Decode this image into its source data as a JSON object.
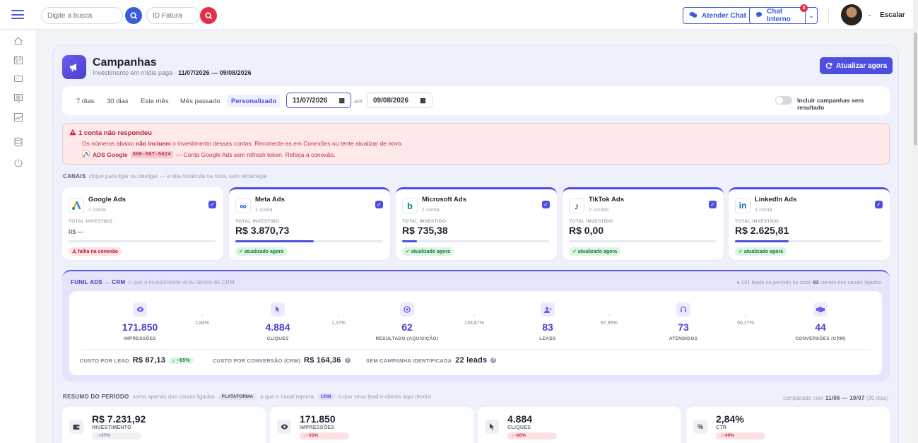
{
  "topbar": {
    "search_placeholder": "Digite a busca",
    "invoice_placeholder": "ID Fatura",
    "atender_chat": "Atender Chat",
    "chat_interno": "Chat Interno",
    "chat_badge": "3",
    "user_menu": "Escalar"
  },
  "header": {
    "title": "Campanhas",
    "subtitle_prefix": "Investimento em mídia paga ·",
    "subtitle_range": "11/07/2026 — 09/08/2026",
    "refresh_label": "Atualizar agora"
  },
  "filters": {
    "periods": [
      "7 dias",
      "30 dias",
      "Este mês",
      "Mês passado",
      "Personalizado"
    ],
    "active_period": "Personalizado",
    "date_from": "11/07/2026",
    "until_label": "até",
    "date_to": "09/08/2026",
    "toggle_label": "Incluir campanhas sem resultado"
  },
  "alert": {
    "title": "1 conta não respondeu",
    "line_a": "Os números abaixo",
    "line_b": "não incluem",
    "line_c": "o investimento dessas contas. Reconecte-as em Conexões ou tente atualizar de novo.",
    "account_name": "ADS Google",
    "account_id": "660-567-5624",
    "account_msg": "— Conta Google Ads sem refresh token. Refaça a conexão."
  },
  "channels": {
    "label": "CANAIS",
    "hint": "clique para ligar ou desligar — a tela recalcula na hora, sem recarregar",
    "invested_label": "TOTAL INVESTIDO",
    "items": [
      {
        "name": "Google Ads",
        "count": "1 conta",
        "value": "R$ —",
        "status": "falha na conexão",
        "bar": 0
      },
      {
        "name": "Meta Ads",
        "count": "1 conta",
        "value": "R$ 3.870,73",
        "status": "atualizado agora",
        "bar": 0.535
      },
      {
        "name": "Microsoft Ads",
        "count": "1 conta",
        "value": "R$ 735,38",
        "status": "atualizado agora",
        "bar": 0.102
      },
      {
        "name": "TikTok Ads",
        "count": "2 contas",
        "value": "R$ 0,00",
        "status": "atualizado agora",
        "bar": 0
      },
      {
        "name": "LinkedIn Ads",
        "count": "1 conta",
        "value": "R$ 2.625,81",
        "status": "atualizado agora",
        "bar": 0.363
      }
    ]
  },
  "funnel": {
    "title": "FUNIL ADS → CRM",
    "hint": "o que o investimento virou dentro do CRM",
    "note_a": "101 leads no período no total;",
    "note_b": "83",
    "note_c": "vieram dos canais ligados",
    "steps": [
      {
        "value": "171.850",
        "label": "IMPRESSÕES",
        "icon": "eye-icon"
      },
      {
        "value": "4.884",
        "label": "CLIQUES",
        "icon": "cursor-icon"
      },
      {
        "value": "62",
        "label": "RESULTADO (AQUISIÇÃO)",
        "icon": "target-icon"
      },
      {
        "value": "83",
        "label": "LEADS",
        "icon": "user-plus-icon"
      },
      {
        "value": "73",
        "label": "ATENDIDOS",
        "icon": "headset-icon"
      },
      {
        "value": "44",
        "label": "CONVERSÕES (CRM)",
        "icon": "handshake-icon"
      }
    ],
    "rates": [
      "2,84%",
      "1,27%",
      "133,87%",
      "87,95%",
      "60,27%"
    ],
    "cpl_label": "CUSTO POR LEAD",
    "cpl_value": "R$ 87,13",
    "cpl_delta": "↓ −65%",
    "cpc_label": "CUSTO POR CONVERSÃO (CRM)",
    "cpc_value": "R$ 164,36",
    "noc_label": "SEM CAMPANHA IDENTIFICADA",
    "noc_value": "22 leads"
  },
  "summary": {
    "label": "RESUMO DO PERÍODO",
    "hint_a": "soma apenas dos canais ligados",
    "tag_platform": "PLATAFORMA",
    "hint_b": "o que o canal reporta",
    "tag_crm": "CRM",
    "hint_c": "o que virou lead e cliente aqui dentro",
    "compare_a": "comparado com",
    "compare_b": "11/06 — 10/07",
    "compare_c": "(30 dias)",
    "cards": [
      {
        "value": "R$ 7.231,92",
        "label": "INVESTIMENTO",
        "delta": "↑+37%",
        "dir": "up"
      },
      {
        "value": "171.850",
        "label": "IMPRESSÕES",
        "delta": "↓−33%",
        "dir": "down"
      },
      {
        "value": "4.884",
        "label": "CLIQUES",
        "delta": "↓−66%",
        "dir": "down"
      },
      {
        "value": "2,84%",
        "label": "CTR",
        "delta": "↓−49%",
        "dir": "down"
      }
    ]
  },
  "colors": {
    "accent": "#4c4fe0",
    "danger": "#e0314b",
    "search_btn": "#3b5bdb"
  }
}
